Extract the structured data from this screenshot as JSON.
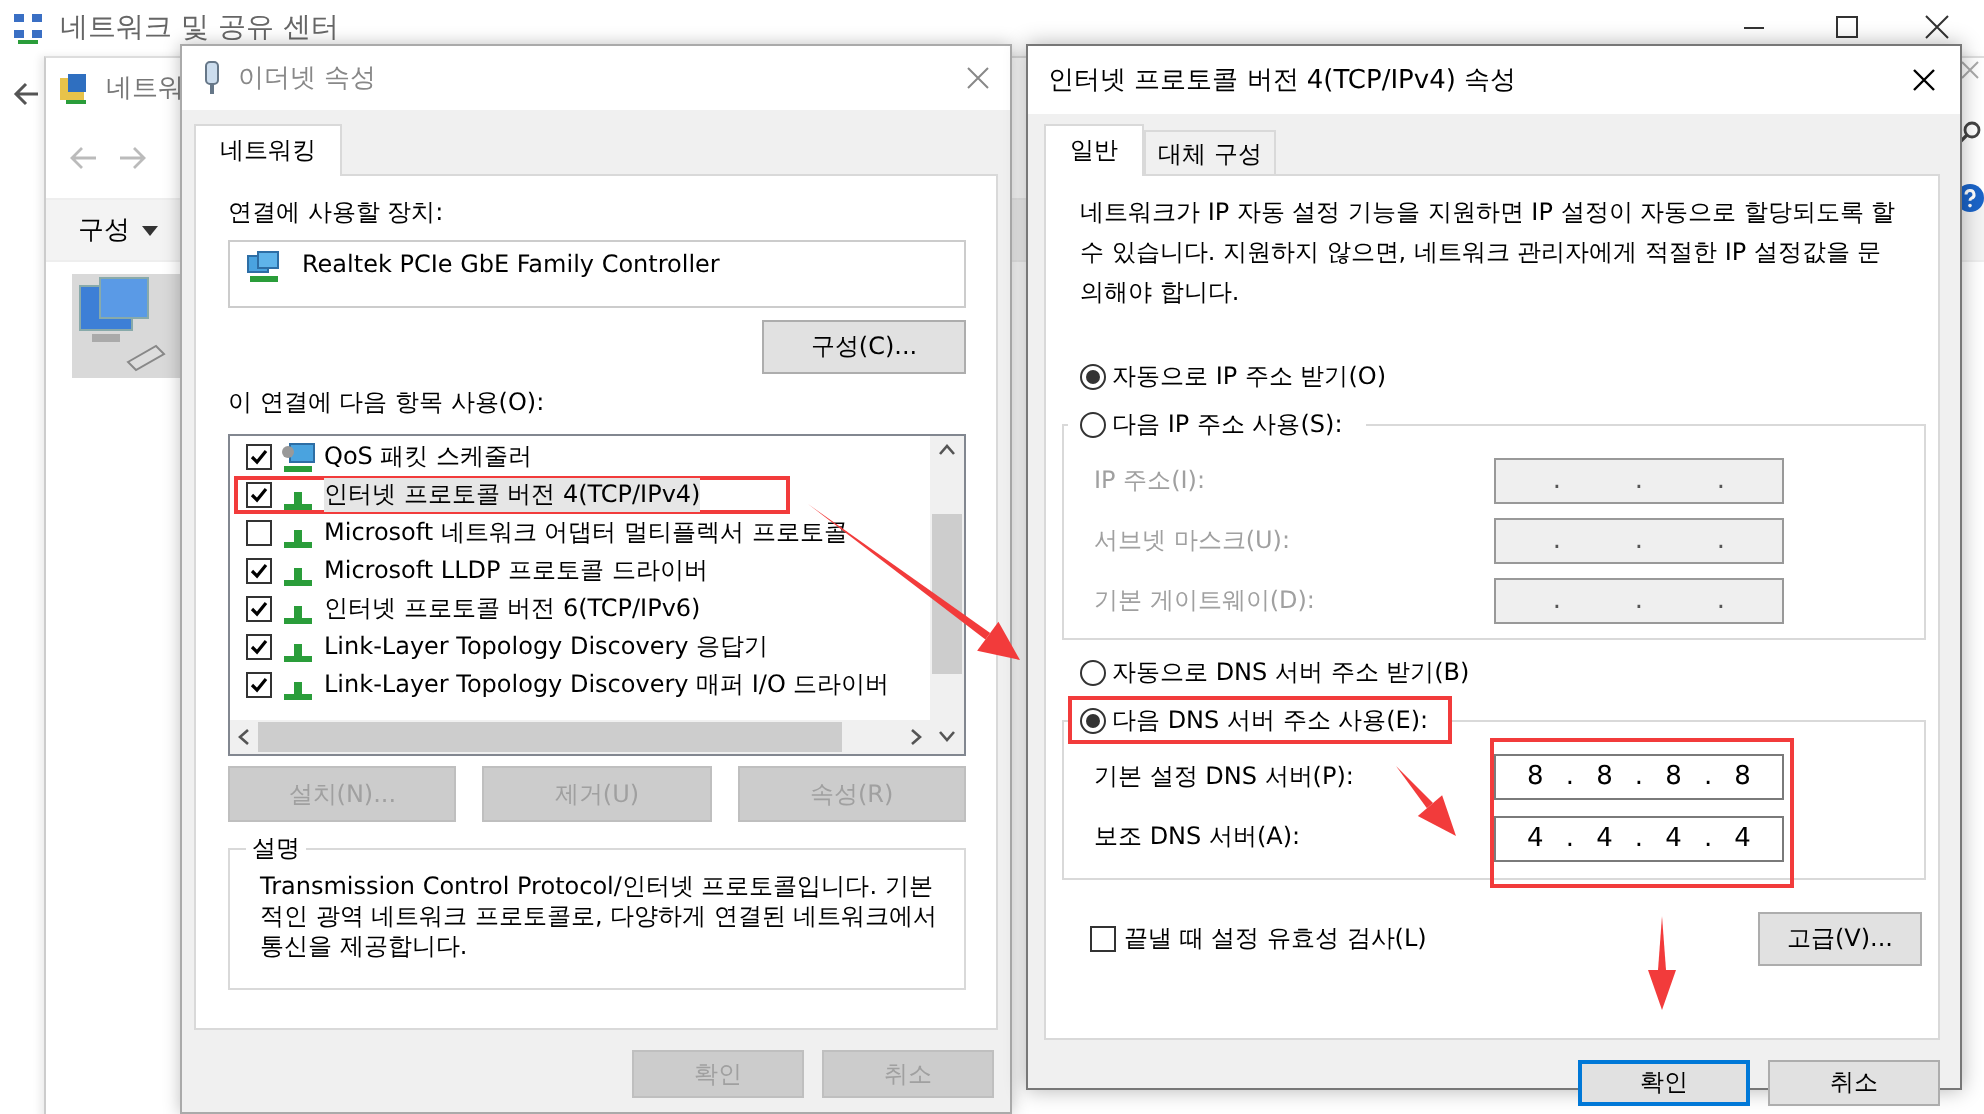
{
  "background_window": {
    "title": "네트워크 및 공유 센터",
    "inner_title": "네트워",
    "toolbar_menu": "구성"
  },
  "ethernet_dialog": {
    "title": "이더넷 속성",
    "tabs": [
      {
        "label": "네트워킹",
        "selected": true
      }
    ],
    "device_label": "연결에 사용할 장치:",
    "device": "Realtek PCIe GbE Family Controller",
    "configure_button": "구성(C)...",
    "items_label": "이 연결에 다음 항목 사용(O):",
    "items": [
      {
        "label": "QoS 패킷 스케줄러",
        "checked": true,
        "highlighted": false,
        "selected": false,
        "kind": "service"
      },
      {
        "label": "인터넷 프로토콜 버전 4(TCP/IPv4)",
        "checked": true,
        "highlighted": true,
        "selected": true,
        "kind": "protocol"
      },
      {
        "label": "Microsoft 네트워크 어댑터 멀티플렉서 프로토콜",
        "checked": false,
        "highlighted": false,
        "selected": false,
        "kind": "protocol"
      },
      {
        "label": "Microsoft LLDP 프로토콜 드라이버",
        "checked": true,
        "highlighted": false,
        "selected": false,
        "kind": "protocol"
      },
      {
        "label": "인터넷 프로토콜 버전 6(TCP/IPv6)",
        "checked": true,
        "highlighted": false,
        "selected": false,
        "kind": "protocol"
      },
      {
        "label": "Link-Layer Topology Discovery 응답기",
        "checked": true,
        "highlighted": false,
        "selected": false,
        "kind": "protocol"
      },
      {
        "label": "Link-Layer Topology Discovery 매퍼 I/O 드라이버",
        "checked": true,
        "highlighted": false,
        "selected": false,
        "kind": "protocol"
      }
    ],
    "buttons": [
      {
        "label": "설치(N)...",
        "disabled": true
      },
      {
        "label": "제거(U)",
        "disabled": true
      },
      {
        "label": "속성(R)",
        "disabled": true
      }
    ],
    "description_title": "설명",
    "description": "Transmission Control Protocol/인터넷 프로토콜입니다. 기본적인 광역 네트워크 프로토콜로, 다양하게 연결된 네트워크에서 통신을 제공합니다.",
    "footer_buttons": [
      {
        "label": "확인",
        "disabled": true
      },
      {
        "label": "취소",
        "disabled": true
      }
    ]
  },
  "ipv4_dialog": {
    "title": "인터넷 프로토콜 버전 4(TCP/IPv4) 속성",
    "tabs": [
      {
        "label": "일반",
        "selected": true
      },
      {
        "label": "대체 구성",
        "selected": false
      }
    ],
    "intro": "네트워크가 IP 자동 설정 기능을 지원하면 IP 설정이 자동으로 할당되도록 할 수 있습니다. 지원하지 않으면, 네트워크 관리자에게 적절한 IP 설정값을 문의해야 합니다.",
    "ip_options": [
      {
        "label": "자동으로 IP 주소 받기(O)",
        "selected": true,
        "highlighted": false
      },
      {
        "label": "다음 IP 주소 사용(S):",
        "selected": false,
        "highlighted": false
      }
    ],
    "ip_fields": [
      {
        "label": "IP 주소(I):",
        "disabled": true,
        "parts": [
          ".",
          ".",
          "."
        ]
      },
      {
        "label": "서브넷 마스크(U):",
        "disabled": true,
        "parts": [
          ".",
          ".",
          "."
        ]
      },
      {
        "label": "기본 게이트웨이(D):",
        "disabled": true,
        "parts": [
          ".",
          ".",
          "."
        ]
      }
    ],
    "dns_options": [
      {
        "label": "자동으로 DNS 서버 주소 받기(B)",
        "selected": false,
        "highlighted": false
      },
      {
        "label": "다음 DNS 서버 주소 사용(E):",
        "selected": true,
        "highlighted": true
      }
    ],
    "dns_fields_highlighted": true,
    "dns_fields": [
      {
        "label": "기본 설정 DNS 서버(P):",
        "disabled": false,
        "parts": [
          "8",
          ".",
          "8",
          ".",
          "8",
          ".",
          "8"
        ]
      },
      {
        "label": "보조 DNS 서버(A):",
        "disabled": false,
        "parts": [
          "4",
          ".",
          "4",
          ".",
          "4",
          ".",
          "4"
        ]
      }
    ],
    "validate": {
      "label": "끝낼 때 설정 유효성 검사(L)",
      "checked": false
    },
    "advanced_button": "고급(V)...",
    "footer_buttons": [
      {
        "label": "확인",
        "default": true
      },
      {
        "label": "취소",
        "default": false
      }
    ]
  }
}
